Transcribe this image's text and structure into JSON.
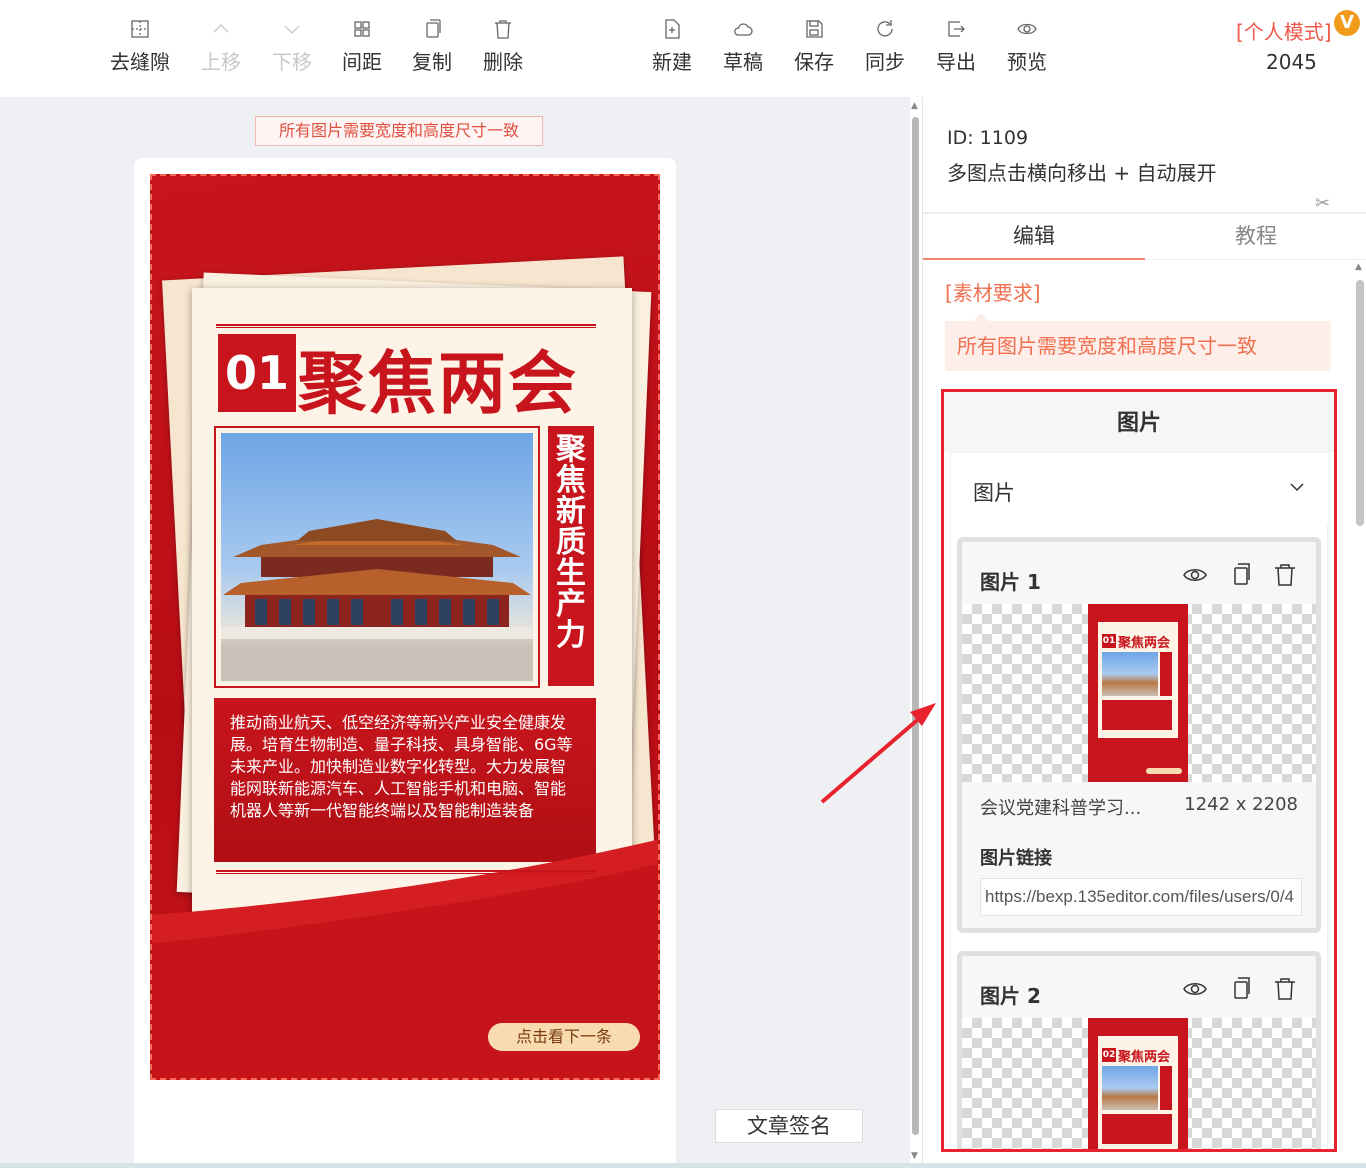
{
  "toolbar": {
    "left": [
      {
        "label": "去缝隙",
        "icon": "collapse-gap-icon",
        "enabled": true
      },
      {
        "label": "上移",
        "icon": "chevron-up-icon",
        "enabled": false
      },
      {
        "label": "下移",
        "icon": "chevron-down-icon",
        "enabled": false
      },
      {
        "label": "间距",
        "icon": "spacing-icon",
        "enabled": true
      },
      {
        "label": "复制",
        "icon": "copy-icon",
        "enabled": true
      },
      {
        "label": "删除",
        "icon": "trash-icon",
        "enabled": true
      }
    ],
    "right": [
      {
        "label": "新建",
        "icon": "new-file-icon"
      },
      {
        "label": "草稿",
        "icon": "cloud-icon"
      },
      {
        "label": "保存",
        "icon": "save-icon"
      },
      {
        "label": "同步",
        "icon": "sync-icon"
      },
      {
        "label": "导出",
        "icon": "export-icon"
      },
      {
        "label": "预览",
        "icon": "eye-icon"
      }
    ],
    "mode_label": "[个人模式]",
    "mode_badge": "V",
    "mode_count": "2045"
  },
  "canvas": {
    "notice": "所有图片需要宽度和高度尺寸一致",
    "signature": "文章签名",
    "poster": {
      "number": "01",
      "headline": "聚焦两会",
      "vertical_text": "聚焦新质生产力",
      "body": "推动商业航天、低空经济等新兴产业安全健康发展。培育生物制造、量子科技、具身智能、6G等未来产业。加快制造业数字化转型。大力发展智能网联新能源汽车、人工智能手机和电脑、智能机器人等新一代智能终端以及智能制造装备",
      "next_button": "点击看下一条"
    }
  },
  "panel": {
    "id": "ID: 1109",
    "description": "多图点击横向移出 + 自动展开",
    "tabs": [
      "编辑",
      "教程"
    ],
    "requirement_title": "[素材要求]",
    "requirement_text": "所有图片需要宽度和高度尺寸一致",
    "group_title": "图片",
    "section_label": "图片",
    "images": [
      {
        "title": "图片 1",
        "thumb_number": "01",
        "thumb_headline": "聚焦两会",
        "filename": "会议党建科普学习...",
        "size": "1242 x 2208",
        "link_label": "图片链接",
        "link": "https://bexp.135editor.com/files/users/0/4"
      },
      {
        "title": "图片 2",
        "thumb_number": "02",
        "thumb_headline": "聚焦两会"
      }
    ]
  },
  "colors": {
    "accent_red": "#c8151d",
    "highlight_border": "#e8222e",
    "notice_text": "#e05040",
    "mode_orange": "#f05a4a"
  }
}
